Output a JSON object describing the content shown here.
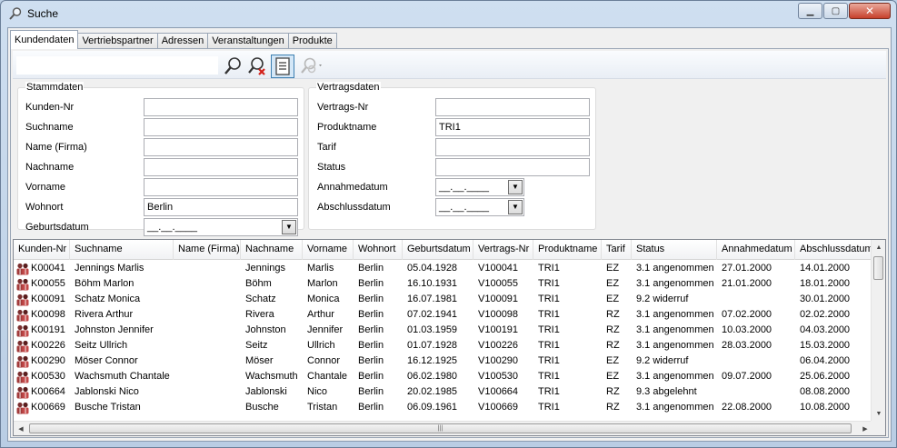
{
  "window": {
    "title": "Suche",
    "min_glyph": "▁",
    "max_glyph": "▢",
    "close_glyph": "✕"
  },
  "tabs": [
    {
      "label": "Kundendaten",
      "active": true
    },
    {
      "label": "Vertriebspartner",
      "active": false
    },
    {
      "label": "Adressen",
      "active": false
    },
    {
      "label": "Veranstaltungen",
      "active": false
    },
    {
      "label": "Produkte",
      "active": false
    }
  ],
  "toolbar": {
    "search_value": "",
    "icons": [
      "search-icon",
      "clear-search-icon",
      "report-icon",
      "disabled-tools-icon"
    ]
  },
  "stammdaten": {
    "legend": "Stammdaten",
    "kunden_nr": {
      "label": "Kunden-Nr",
      "value": ""
    },
    "suchname": {
      "label": "Suchname",
      "value": ""
    },
    "name_firma": {
      "label": "Name (Firma)",
      "value": ""
    },
    "nachname": {
      "label": "Nachname",
      "value": ""
    },
    "vorname": {
      "label": "Vorname",
      "value": ""
    },
    "wohnort": {
      "label": "Wohnort",
      "value": "Berlin"
    },
    "geburtsdatum": {
      "label": "Geburtsdatum",
      "value": "__.__.____"
    }
  },
  "vertragsdaten": {
    "legend": "Vertragsdaten",
    "vertrags_nr": {
      "label": "Vertrags-Nr",
      "value": ""
    },
    "produktname": {
      "label": "Produktname",
      "value": "TRI1"
    },
    "tarif": {
      "label": "Tarif",
      "value": ""
    },
    "status": {
      "label": "Status",
      "value": ""
    },
    "annahmedatum": {
      "label": "Annahmedatum",
      "value": "__.__.____"
    },
    "abschlussdatum": {
      "label": "Abschlussdatum",
      "value": "__.__.____"
    }
  },
  "dropdown_glyph": "▼",
  "scroll": {
    "up": "▲",
    "down": "▼",
    "left": "◀",
    "right": "▶",
    "grip": "|||"
  },
  "grid": {
    "columns": [
      "Kunden-Nr",
      "Suchname",
      "Name (Firma)",
      "Nachname",
      "Vorname",
      "Wohnort",
      "Geburtsdatum",
      "Vertrags-Nr",
      "Produktname",
      "Tarif",
      "Status",
      "Annahmedatum",
      "Abschlussdatum"
    ],
    "rows": [
      [
        "K00041",
        "Jennings Marlis",
        "",
        "Jennings",
        "Marlis",
        "Berlin",
        "05.04.1928",
        "V100041",
        "TRI1",
        "EZ",
        "3.1 angenommen",
        "27.01.2000",
        "14.01.2000"
      ],
      [
        "K00055",
        "Böhm Marlon",
        "",
        "Böhm",
        "Marlon",
        "Berlin",
        "16.10.1931",
        "V100055",
        "TRI1",
        "EZ",
        "3.1 angenommen",
        "21.01.2000",
        "18.01.2000"
      ],
      [
        "K00091",
        "Schatz Monica",
        "",
        "Schatz",
        "Monica",
        "Berlin",
        "16.07.1981",
        "V100091",
        "TRI1",
        "EZ",
        "9.2 widerruf",
        "",
        "30.01.2000"
      ],
      [
        "K00098",
        "Rivera Arthur",
        "",
        "Rivera",
        "Arthur",
        "Berlin",
        "07.02.1941",
        "V100098",
        "TRI1",
        "RZ",
        "3.1 angenommen",
        "07.02.2000",
        "02.02.2000"
      ],
      [
        "K00191",
        "Johnston Jennifer",
        "",
        "Johnston",
        "Jennifer",
        "Berlin",
        "01.03.1959",
        "V100191",
        "TRI1",
        "RZ",
        "3.1 angenommen",
        "10.03.2000",
        "04.03.2000"
      ],
      [
        "K00226",
        "Seitz Ullrich",
        "",
        "Seitz",
        "Ullrich",
        "Berlin",
        "01.07.1928",
        "V100226",
        "TRI1",
        "RZ",
        "3.1 angenommen",
        "28.03.2000",
        "15.03.2000"
      ],
      [
        "K00290",
        "Möser Connor",
        "",
        "Möser",
        "Connor",
        "Berlin",
        "16.12.1925",
        "V100290",
        "TRI1",
        "EZ",
        "9.2 widerruf",
        "",
        "06.04.2000"
      ],
      [
        "K00530",
        "Wachsmuth Chantale",
        "",
        "Wachsmuth",
        "Chantale",
        "Berlin",
        "06.02.1980",
        "V100530",
        "TRI1",
        "EZ",
        "3.1 angenommen",
        "09.07.2000",
        "25.06.2000"
      ],
      [
        "K00664",
        "Jablonski Nico",
        "",
        "Jablonski",
        "Nico",
        "Berlin",
        "20.02.1985",
        "V100664",
        "TRI1",
        "RZ",
        "9.3 abgelehnt",
        "",
        "08.08.2000"
      ],
      [
        "K00669",
        "Busche Tristan",
        "",
        "Busche",
        "Tristan",
        "Berlin",
        "06.09.1961",
        "V100669",
        "TRI1",
        "RZ",
        "3.1 angenommen",
        "22.08.2000",
        "10.08.2000"
      ]
    ]
  }
}
